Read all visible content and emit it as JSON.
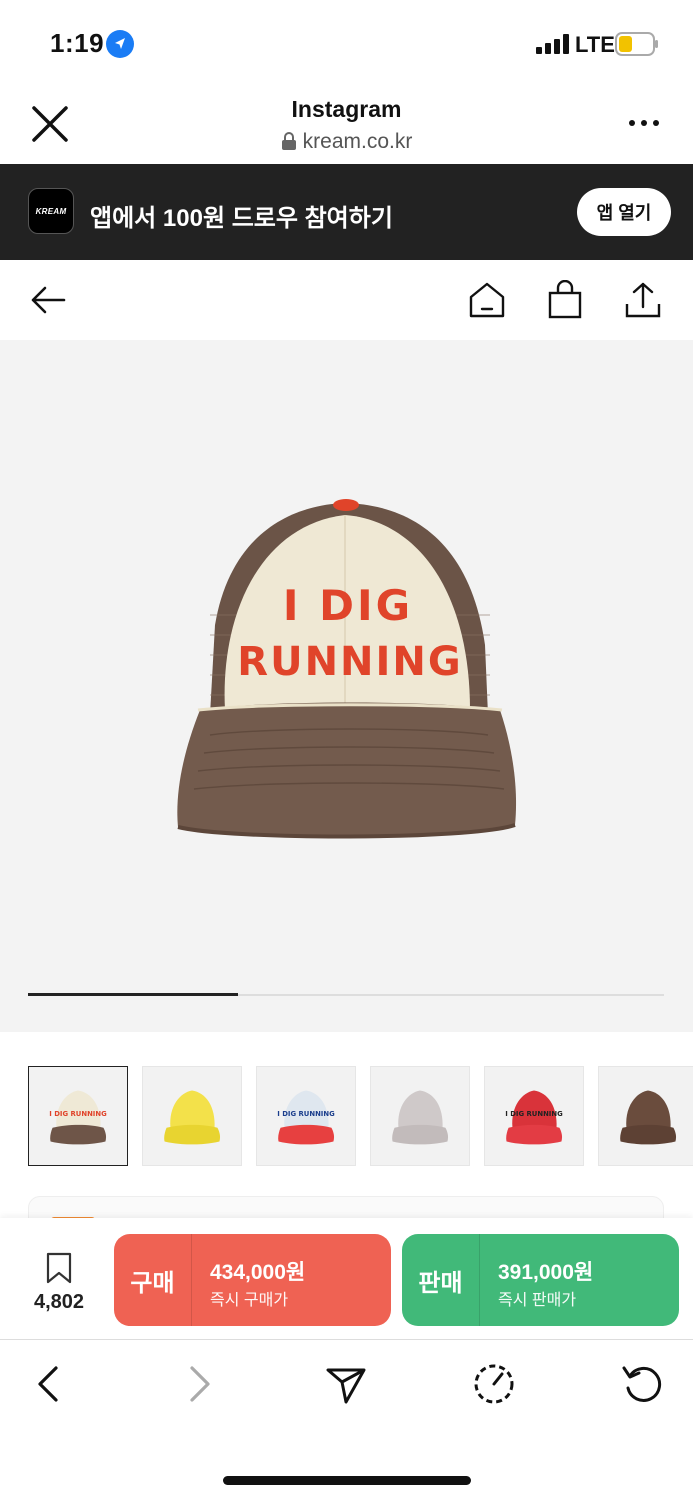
{
  "status_bar": {
    "time": "1:19",
    "network": "LTE"
  },
  "browser": {
    "title": "Instagram",
    "url": "kream.co.kr"
  },
  "app_banner": {
    "logo_text": "KREAM",
    "text": "앱에서 100원 드로우 참여하기",
    "button_label": "앱 열기"
  },
  "product": {
    "cap_text_line1": "I DIG",
    "cap_text_line2": "RUNNING",
    "image_progress": 0.33,
    "thumbnails": [
      {
        "name": "brown-cream",
        "crown": "#efe9d6",
        "brim": "#6e5548",
        "text": "I DIG RUNNING",
        "text_color": "#e0442a"
      },
      {
        "name": "yellow",
        "crown": "#f3e14a",
        "brim": "#e8d430",
        "text": "",
        "text_color": "#e0442a"
      },
      {
        "name": "blue-red",
        "crown": "#dfe7ef",
        "brim": "#e74040",
        "text": "I DIG RUNNING",
        "text_color": "#1b3e8c"
      },
      {
        "name": "gray",
        "crown": "#cfc9c9",
        "brim": "#c2bbbb",
        "text": "",
        "text_color": "#ffffff"
      },
      {
        "name": "red",
        "crown": "#d9333a",
        "brim": "#e33c44",
        "text": "I DIG RUNNING",
        "text_color": "#222222"
      },
      {
        "name": "brown-dark",
        "crown": "#6a4c3d",
        "brim": "#5d4134",
        "text": "",
        "text_color": "#e0442a"
      }
    ]
  },
  "actions": {
    "bookmark_count": "4,802",
    "buy": {
      "label": "구매",
      "price": "434,000원",
      "sub": "즉시 구매가"
    },
    "sell": {
      "label": "판매",
      "price": "391,000원",
      "sub": "즉시 판매가"
    }
  },
  "colors": {
    "buy": "#ef6253",
    "sell": "#41b979",
    "banner": "#222222",
    "location": "#1a7cf5"
  }
}
